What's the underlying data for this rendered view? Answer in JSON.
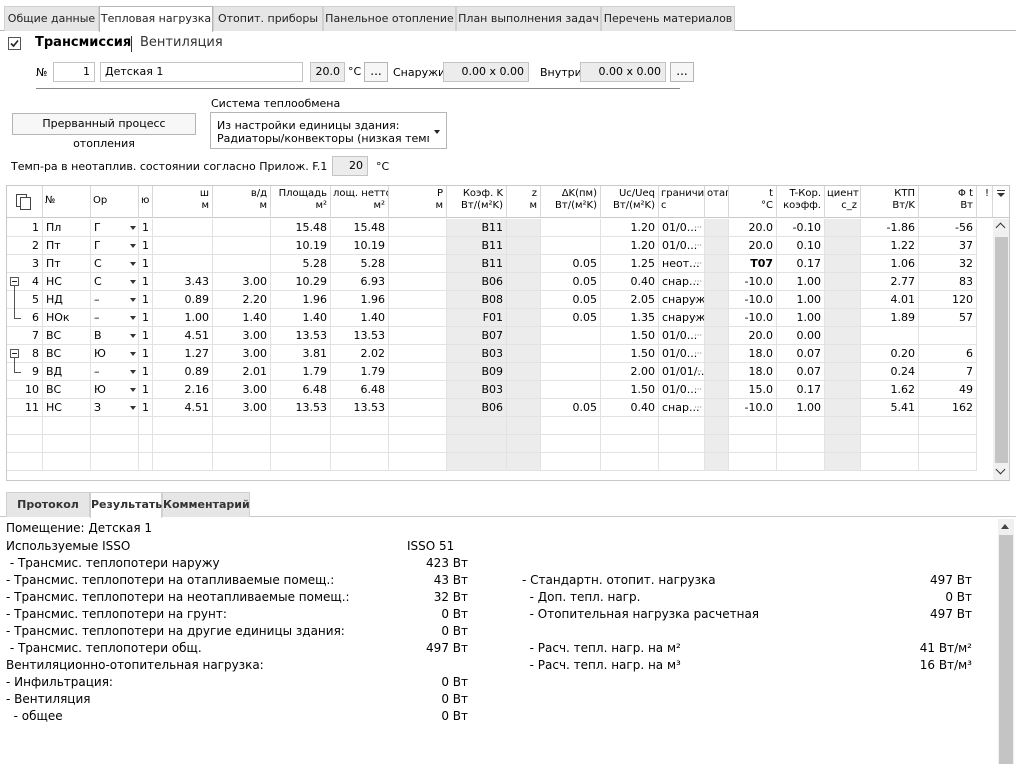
{
  "top_tabs": [
    "Общие данные",
    "Тепловая нагрузка",
    "Отопит. приборы",
    "Панельное отопление",
    "План выполнения задач",
    "Перечень материалов"
  ],
  "mode": {
    "transmission": "Трансмиссия",
    "ventilation": "Вентиляция",
    "checked": true
  },
  "room": {
    "no_label": "№",
    "no_value": "1",
    "name": "Детская 1",
    "temp_value": "20.0",
    "temp_unit": "°C",
    "outside_label": "Снаружи",
    "outside_value": "0.00 x 0.00",
    "inside_label": "Внутри",
    "inside_value": "0.00 x 0.00",
    "dots": "..."
  },
  "interrupted_button": "Прерванный процесс отопления",
  "system": {
    "label": "Система теплообмена",
    "line1": "Из настройки единицы здания:",
    "line2": "Радиаторы/конвекторы (низкая темп-ра)"
  },
  "temp_unheated": {
    "label": "Темп-ра в неотаплив. состоянии согласно Прилож. F.1",
    "value": "20",
    "unit": "°C"
  },
  "grid": {
    "headers": [
      [
        "",
        ""
      ],
      [
        "№",
        ""
      ],
      [
        "Ор",
        ""
      ],
      [
        "ю",
        ""
      ],
      [
        "ш",
        "м"
      ],
      [
        "в/д",
        "м"
      ],
      [
        "Площадь",
        "м²"
      ],
      [
        "лощ. нетто",
        "м²"
      ],
      [
        "Р",
        "м"
      ],
      [
        "Коэф. K",
        "Вт/(м²K)"
      ],
      [
        "z",
        "м"
      ],
      [
        "ΔK(пм)",
        "Вт/(м²K)"
      ],
      [
        "Uc/Ueq",
        "Вт/(м²K)"
      ],
      [
        "граничит",
        "с"
      ],
      [
        "отаг",
        ""
      ],
      [
        "t",
        "°C"
      ],
      [
        "T-Кор.",
        "коэфф."
      ],
      [
        "циент",
        "c_z"
      ],
      [
        "КТП",
        "Вт/K"
      ],
      [
        "Φ t",
        "Вт"
      ],
      [
        "!",
        ""
      ]
    ],
    "rows": [
      [
        "1",
        "Пл",
        "Г",
        "1",
        "",
        "",
        "15.48",
        "15.48",
        "",
        "B11",
        "",
        "",
        "1.20",
        "01/0...",
        "",
        "20.0",
        "-0.10",
        "",
        "-1.86",
        "-56"
      ],
      [
        "2",
        "Пт",
        "Г",
        "1",
        "",
        "",
        "10.19",
        "10.19",
        "",
        "B11",
        "",
        "",
        "1.20",
        "01/0...",
        "",
        "20.0",
        "0.10",
        "",
        "1.22",
        "37"
      ],
      [
        "3",
        "Пт",
        "С",
        "1",
        "",
        "",
        "5.28",
        "5.28",
        "",
        "B11",
        "",
        "0.05",
        "1.25",
        "неот...",
        "",
        "T07",
        "0.17",
        "",
        "1.06",
        "32"
      ],
      [
        "4",
        "НС",
        "С",
        "1",
        "3.43",
        "3.00",
        "10.29",
        "6.93",
        "",
        "B06",
        "",
        "0.05",
        "0.40",
        "снар...",
        "",
        "-10.0",
        "1.00",
        "",
        "2.77",
        "83"
      ],
      [
        "5",
        "НД",
        "–",
        "1",
        "0.89",
        "2.20",
        "1.96",
        "1.96",
        "",
        "B08",
        "",
        "0.05",
        "2.05",
        "снаружи",
        "",
        "-10.0",
        "1.00",
        "",
        "4.01",
        "120"
      ],
      [
        "6",
        "НОк",
        "–",
        "1",
        "1.00",
        "1.40",
        "1.40",
        "1.40",
        "",
        "F01",
        "",
        "0.05",
        "1.35",
        "снаружи",
        "",
        "-10.0",
        "1.00",
        "",
        "1.89",
        "57"
      ],
      [
        "7",
        "ВС",
        "В",
        "1",
        "4.51",
        "3.00",
        "13.53",
        "13.53",
        "",
        "B07",
        "",
        "",
        "1.50",
        "01/0...",
        "",
        "20.0",
        "0.00",
        "",
        "",
        ""
      ],
      [
        "8",
        "ВС",
        "Ю",
        "1",
        "1.27",
        "3.00",
        "3.81",
        "2.02",
        "",
        "B03",
        "",
        "",
        "1.50",
        "01/0...",
        "",
        "18.0",
        "0.07",
        "",
        "0.20",
        "6"
      ],
      [
        "9",
        "ВД",
        "–",
        "1",
        "0.89",
        "2.01",
        "1.79",
        "1.79",
        "",
        "B09",
        "",
        "",
        "2.00",
        "01/01/...",
        "",
        "18.0",
        "0.07",
        "",
        "0.24",
        "7"
      ],
      [
        "10",
        "ВС",
        "Ю",
        "1",
        "2.16",
        "3.00",
        "6.48",
        "6.48",
        "",
        "B03",
        "",
        "",
        "1.50",
        "01/0...",
        "",
        "15.0",
        "0.17",
        "",
        "1.62",
        "49"
      ],
      [
        "11",
        "НС",
        "З",
        "1",
        "4.51",
        "3.00",
        "13.53",
        "13.53",
        "",
        "B06",
        "",
        "0.05",
        "0.40",
        "снар...",
        "",
        "-10.0",
        "1.00",
        "",
        "5.41",
        "162"
      ]
    ]
  },
  "bottom_tabs": [
    "Протокол",
    "Результаты",
    "Комментарий"
  ],
  "results": {
    "room": "Помещение: Детская 1",
    "isso_label": "Используемые ISSO",
    "isso_value": "ISSO 51",
    "left": [
      {
        "label": " - Трансмис. теплопотери наружу",
        "value": "423 Вт"
      },
      {
        "label": "- Трансмис. теплопотери на отапливаемые помещ.:",
        "value": "43 Вт"
      },
      {
        "label": "- Трансмис. теплопотери на неотапливаемые помещ.:",
        "value": "32 Вт"
      },
      {
        "label": "- Трансмис. теплопотери на грунт:",
        "value": "0 Вт"
      },
      {
        "label": "- Трансмис. теплопотери на другие единицы здания:",
        "value": "0 Вт"
      },
      {
        "label": " - Трансмис. теплопотери общ.",
        "value": "497 Вт"
      },
      {
        "label": "Вентиляционно-отопительная нагрузка:",
        "value": ""
      },
      {
        "label": "- Инфильтрация:",
        "value": "0 Вт"
      },
      {
        "label": "- Вентиляция",
        "value": "0 Вт"
      },
      {
        "label": "  - общее",
        "value": "0 Вт"
      }
    ],
    "right": [
      {
        "label": "- Стандартн. отопит. нагрузка",
        "value": "497 Вт"
      },
      {
        "label": "  - Доп. тепл. нагр.",
        "value": "0 Вт"
      },
      {
        "label": "  - Отопительная нагрузка расчетная",
        "value": "497 Вт"
      },
      {
        "label": "  - Расч. тепл. нагр. на м²",
        "value": "41 Вт/м²"
      },
      {
        "label": "  - Расч. тепл. нагр. на м³",
        "value": "16 Вт/м³"
      }
    ]
  }
}
